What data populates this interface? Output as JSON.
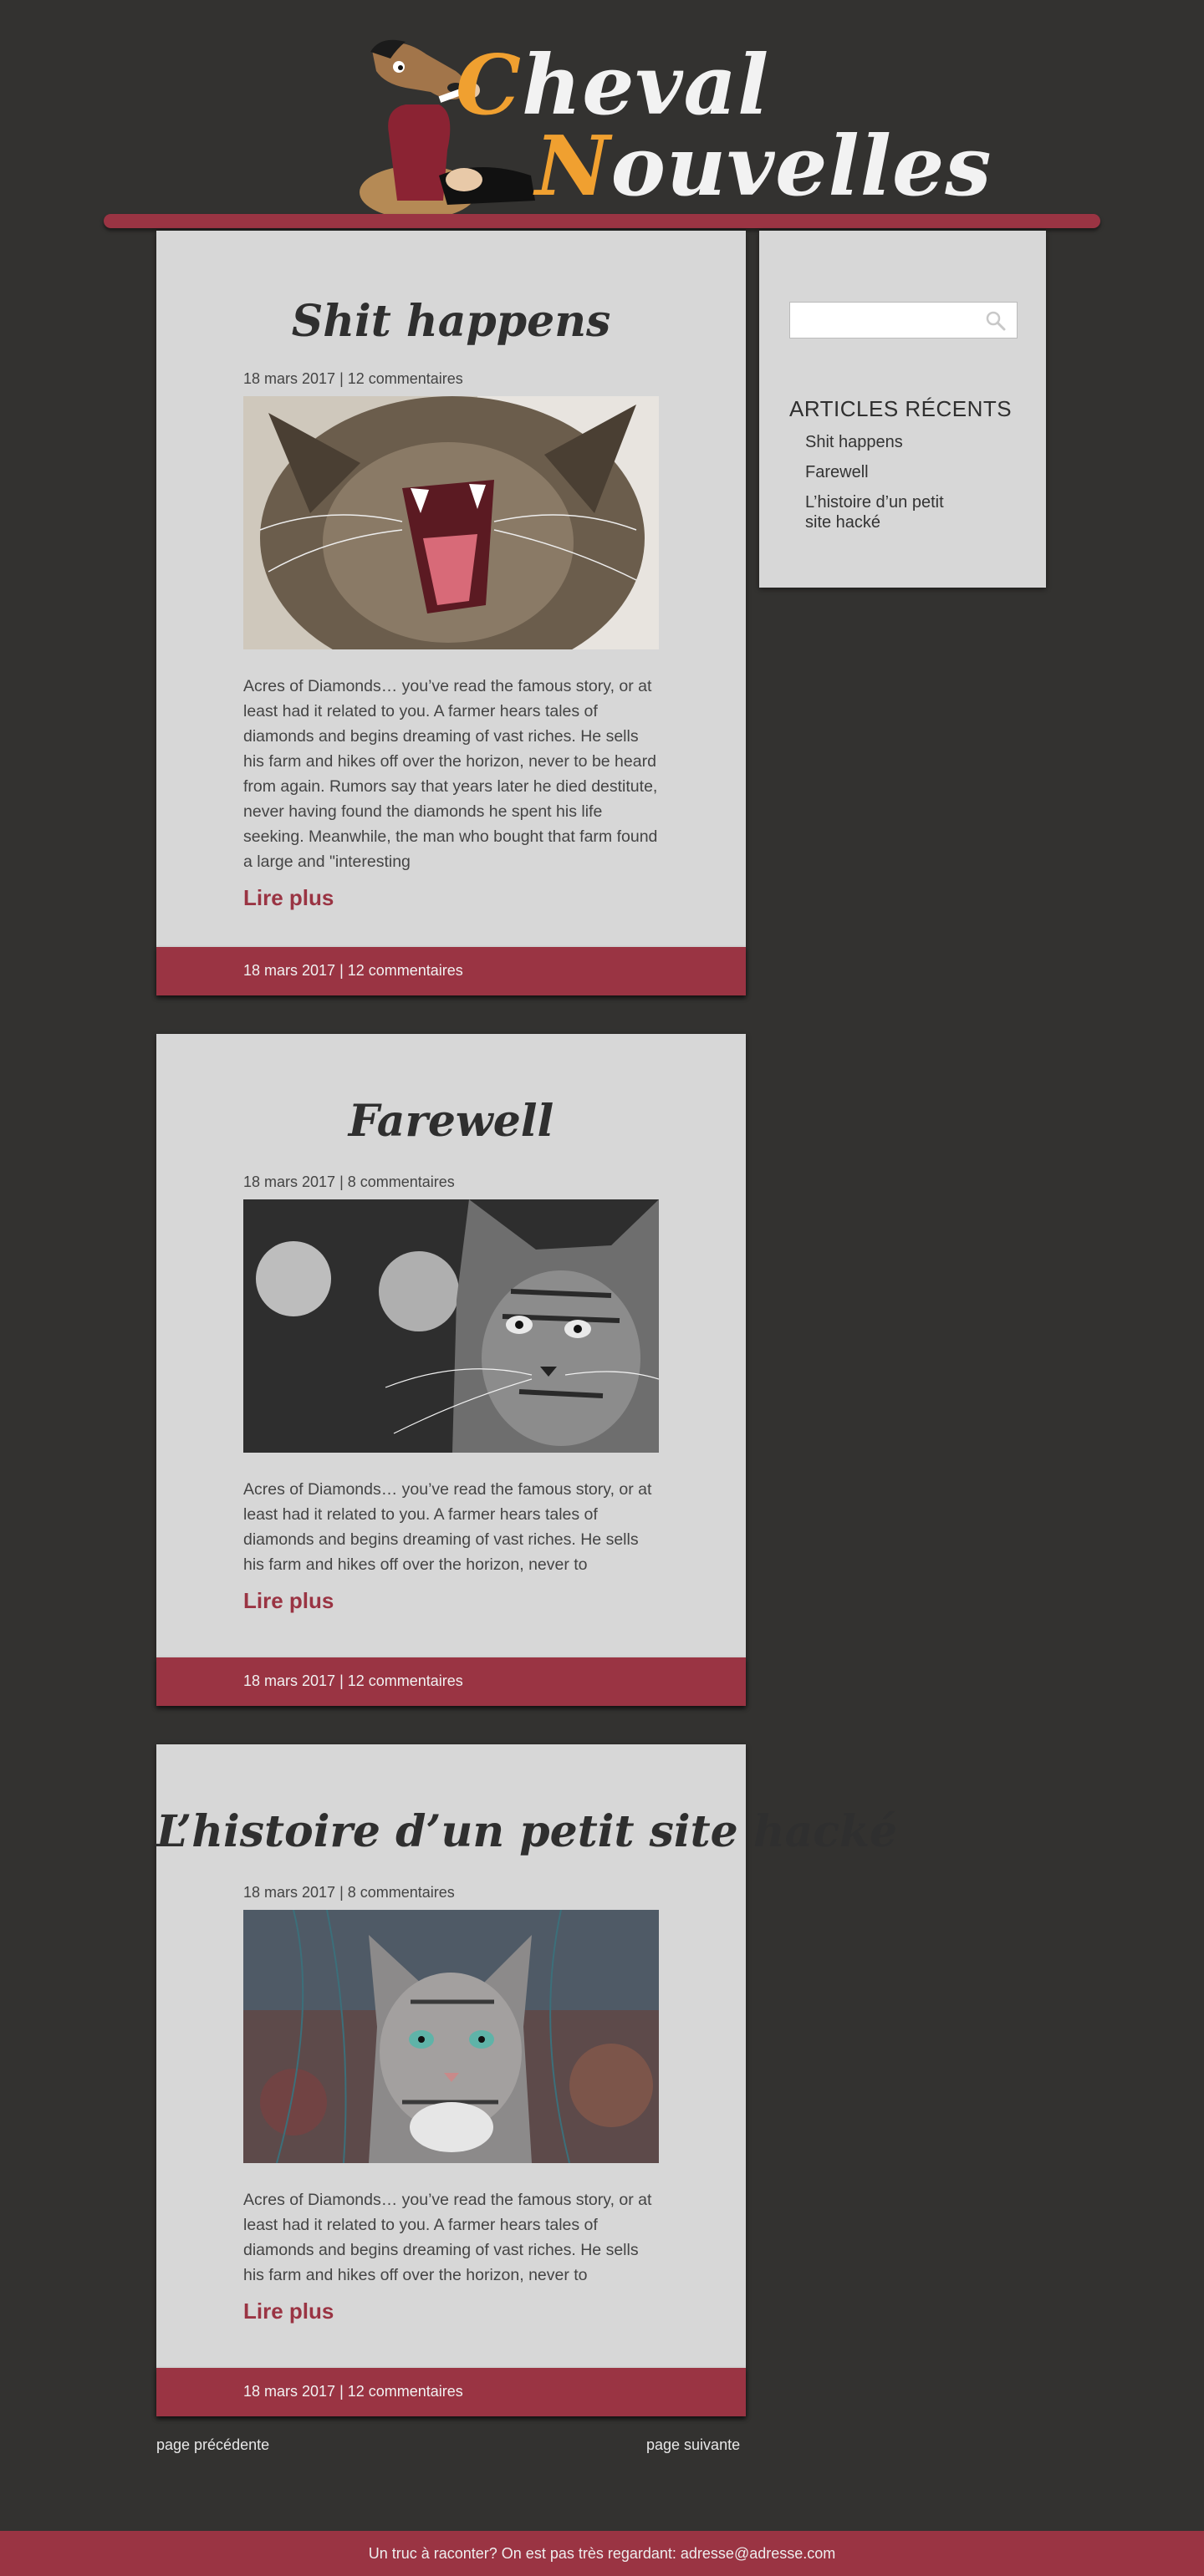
{
  "site": {
    "title_line1_cap": "C",
    "title_line1_rest": "heval",
    "title_line2_cap": "N",
    "title_line2_rest": "ouvelles"
  },
  "articles": [
    {
      "title": "Shit happens",
      "meta": "18 mars 2017 | 12 commentaires",
      "excerpt": "Acres of Diamonds… you’ve read the famous story, or at least had it related to you. A farmer hears tales of diamonds and begins dreaming of vast riches. He sells his farm and hikes off over the horizon, never to be heard from again. Rumors say that years later he died destitute, never having found the diamonds he spent his life seeking. Meanwhile, the man who bought that farm found a large and \"interesting",
      "read_more": "Lire plus",
      "footer": "18 mars 2017 | 12 commentaires"
    },
    {
      "title": "Farewell",
      "meta": "18 mars 2017 | 8 commentaires",
      "excerpt": "Acres of Diamonds… you’ve read the famous story, or at least had it related to you. A farmer hears tales of diamonds and begins dreaming of vast riches. He sells his farm and hikes off over the horizon, never to",
      "read_more": "Lire plus",
      "footer": "18 mars 2017 | 12 commentaires"
    },
    {
      "title": "L’histoire d’un petit site hacké",
      "meta": "18 mars 2017 | 8 commentaires",
      "excerpt": "Acres of Diamonds… you’ve read the famous story, or at least had it related to you. A farmer hears tales of diamonds and begins dreaming of vast riches. He sells his farm and hikes off over the horizon, never to",
      "read_more": "Lire plus",
      "footer": "18 mars 2017 | 12 commentaires"
    }
  ],
  "sidebar": {
    "search_placeholder": "",
    "heading": "ARTICLES RÉCENTS",
    "recent": [
      "Shit happens",
      "Farewell",
      "L’histoire d’un petit site hacké"
    ]
  },
  "pager": {
    "prev": "page précédente",
    "next": "page suivante"
  },
  "footer": {
    "text": "Un truc à raconter? On est pas très regardant: adresse@adresse.com"
  },
  "colors": {
    "background": "#333230",
    "accent": "#9a3443",
    "card": "#d7d7d7",
    "logo_cap": "#f0a030"
  },
  "icons": {
    "search": "search-icon",
    "logo": "horse-mascot-icon"
  }
}
